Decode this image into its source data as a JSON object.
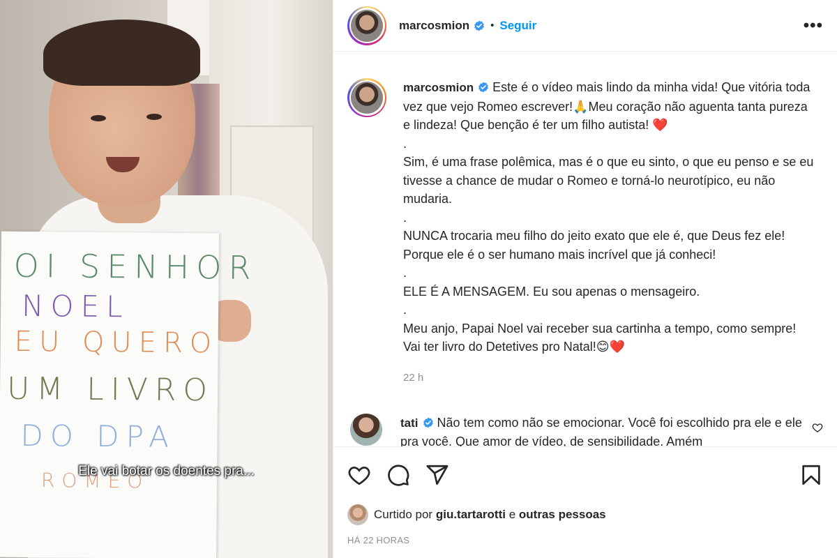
{
  "post": {
    "username": "marcosmion",
    "follow_label": "Seguir",
    "more_label": "•••",
    "separator": "•"
  },
  "media": {
    "subtitle": "Ele vai botar os doentes pra...",
    "handwriting": {
      "line1": "OI SENHOR",
      "line2": "NOEL",
      "line3": "EU QUERO",
      "line4": "UM LIVRO",
      "line5": "DO DPA",
      "line6": "ROMEO"
    }
  },
  "caption": {
    "username": "marcosmion",
    "para1": "Este é o vídeo mais lindo da minha vida! Que vitória toda vez que vejo Romeo escrever!🙏Meu coração não aguenta tanta pureza e lindeza! Que benção é ter um filho autista! ❤️",
    "sep1": ".",
    "para2": "Sim, é uma frase polêmica, mas é o que eu sinto, o que eu penso e se eu tivesse a chance de mudar o Romeo e torná-lo neurotípico, eu não mudaria.",
    "sep2": ".",
    "para3": "NUNCA trocaria meu filho do jeito exato que ele é, que Deus fez ele! Porque ele é o ser humano mais incrível que já conheci!",
    "sep3": ".",
    "para4": "ELE É A MENSAGEM. Eu sou apenas o mensageiro.",
    "sep4": ".",
    "para5": "Meu anjo, Papai Noel vai receber sua cartinha a tempo, como sempre! Vai ter livro do Detetives pro Natal!😊❤️",
    "time": "22 h"
  },
  "comment": {
    "username": "tati",
    "text": "Não tem como não se emocionar. Você foi escolhido pra ele e ele pra você. Que amor de vídeo, de sensibilidade. Amém"
  },
  "likes": {
    "prefix": "Curtido por",
    "user": "giu.tartarotti",
    "conj": "e",
    "others": "outras pessoas"
  },
  "timestamp": "HÁ 22 HORAS",
  "colors": {
    "accent": "#0095f6",
    "verified": "#3897f0",
    "text": "#262626",
    "muted": "#8e8e8e"
  },
  "icons": [
    "heart-icon",
    "comment-icon",
    "share-icon",
    "bookmark-icon",
    "verified-icon",
    "more-icon"
  ]
}
